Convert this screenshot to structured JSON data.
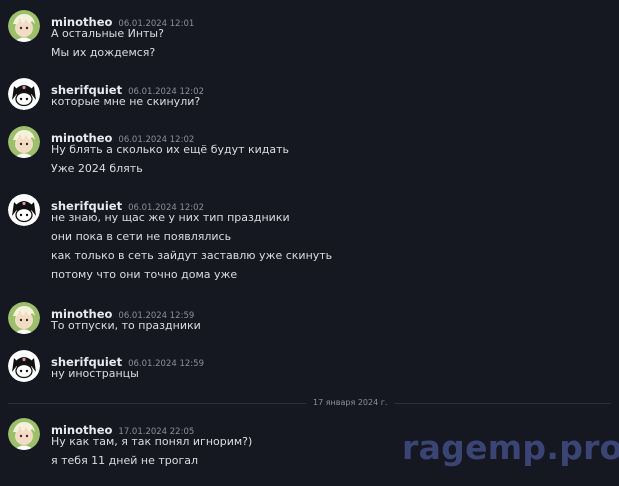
{
  "users": {
    "minotheo": "minotheo",
    "sherifquiet": "sherifquiet"
  },
  "groups": [
    {
      "user": "minotheo",
      "time": "06.01.2024 12:01",
      "lines": [
        "А остальные Инты?",
        "Мы их дождемся?"
      ]
    },
    {
      "user": "sherifquiet",
      "time": "06.01.2024 12:02",
      "lines": [
        "которые мне не скинули?"
      ]
    },
    {
      "user": "minotheo",
      "time": "06.01.2024 12:02",
      "lines": [
        "Ну блять а сколько их ещё будут кидать",
        "Уже 2024 блять"
      ]
    },
    {
      "user": "sherifquiet",
      "time": "06.01.2024 12:02",
      "lines": [
        "не знаю, ну щас же у них тип праздники",
        "они пока в сети не появлялись",
        "как только в сеть зайдут заставлю уже скинуть",
        "потому что они точно дома уже"
      ]
    },
    {
      "user": "minotheo",
      "time": "06.01.2024 12:59",
      "lines": [
        "То отпуски, то праздники"
      ]
    },
    {
      "user": "sherifquiet",
      "time": "06.01.2024 12:59",
      "lines": [
        "ну иностранцы"
      ]
    },
    {
      "user": "minotheo",
      "time": "17.01.2024 22:05",
      "lines": [
        "Ну как там, я так понял игнорим?)",
        "я тебя 11 дней не трогал"
      ]
    }
  ],
  "date_separator": "17 января 2024 г.",
  "watermark": "ragemp.pro",
  "colors": {
    "background": "#161821",
    "username": "#e8e9ee",
    "message_text": "#dcdde2",
    "timestamp": "#8b8e99",
    "watermark": "#3b4575"
  },
  "icons": {
    "minotheo_avatar": "anime-character-avatar-icon",
    "sherifquiet_avatar": "kuromi-avatar-icon"
  }
}
